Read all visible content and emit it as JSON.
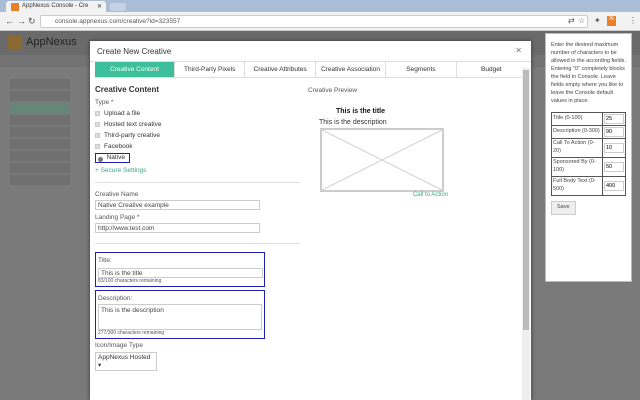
{
  "browser": {
    "tab_title": "AppNexus Console - Cre",
    "url": "console.appnexus.com/creative?id=323557"
  },
  "app": {
    "brand": "AppNexus"
  },
  "modal": {
    "title": "Create New Creative",
    "tabs": [
      "Creative Content",
      "Third-Party Pixels",
      "Creative Attributes",
      "Creative Association",
      "Segments",
      "Budget"
    ],
    "section_title": "Creative Content",
    "type_label": "Type *",
    "type_options": [
      "Upload a file",
      "Hosted text creative",
      "Third-party creative",
      "Facebook",
      "Native"
    ],
    "selected_type": "Native",
    "secure_settings": "+ Secure Settings",
    "creative_name_label": "Creative Name",
    "creative_name_value": "Native Creative example",
    "landing_page_label": "Landing Page *",
    "landing_page_value": "http://www.test.com",
    "title_label": "Title:",
    "title_value": "This is the title",
    "title_remaining": "83/100 characters remaining",
    "description_label": "Description:",
    "description_value": "This is the description",
    "description_remaining": "277/300 characters remaining",
    "icon_type_label": "Icon/Image Type",
    "icon_type_value": "AppNexus Hosted",
    "preview": {
      "label": "Creative Preview",
      "title": "This is the title",
      "description": "This is the description",
      "cta": "Call to Action"
    }
  },
  "popup": {
    "instructions": "Enter the desired maximum number of characters to be allowed in the according fields. Entering \"0\" completely blocks the field in Console. Leave fields empty where you like to leave the Console default values in place.",
    "rows": [
      {
        "label": "Title (0-100)",
        "value": "25"
      },
      {
        "label": "Description (0-300)",
        "value": "90"
      },
      {
        "label": "Call To Action (0-20)",
        "value": "10"
      },
      {
        "label": "Sponsored By (0-100)",
        "value": "50"
      },
      {
        "label": "Full Body Text (0-500)",
        "value": "400"
      }
    ],
    "save_label": "Save"
  },
  "colors": {
    "accent": "#3cbf9a",
    "highlight": "#2020b0"
  }
}
